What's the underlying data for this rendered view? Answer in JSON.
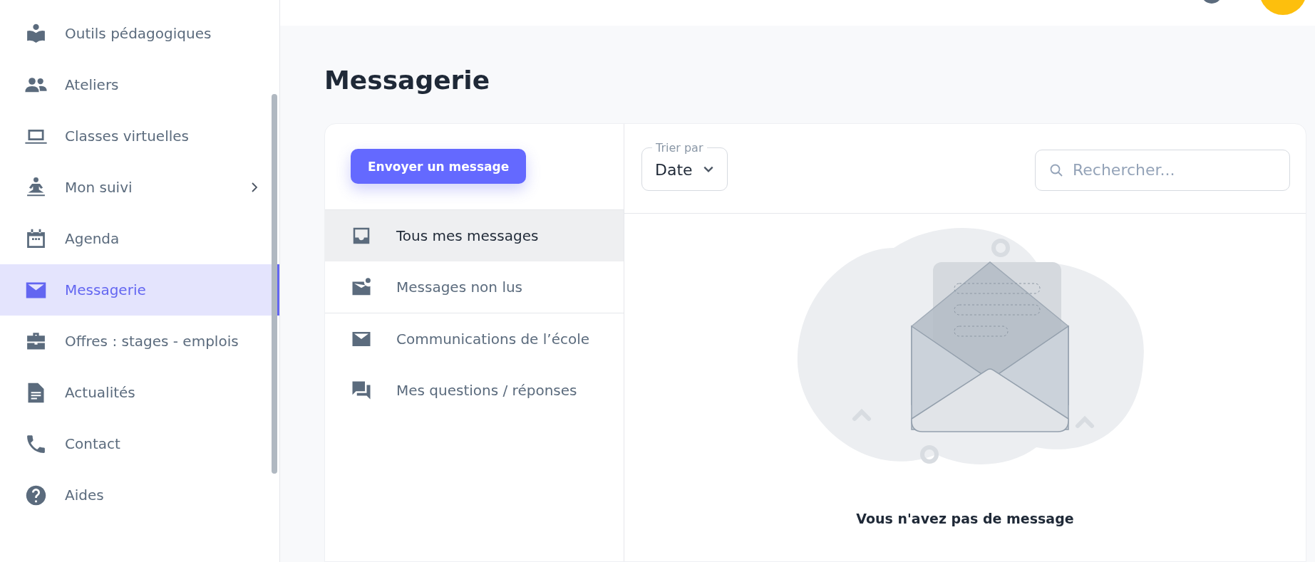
{
  "sidebar": {
    "items": [
      {
        "label": "Outils pédagogiques",
        "selected": false,
        "kind": "link"
      },
      {
        "label": "Ateliers",
        "selected": false,
        "kind": "link"
      },
      {
        "label": "Classes virtuelles",
        "selected": false,
        "kind": "link"
      },
      {
        "label": "Mon suivi",
        "selected": false,
        "kind": "submenu"
      },
      {
        "label": "Agenda",
        "selected": false,
        "kind": "link"
      },
      {
        "label": "Messagerie",
        "selected": true,
        "kind": "link"
      },
      {
        "label": "Offres : stages - emplois",
        "selected": false,
        "kind": "link"
      },
      {
        "label": "Actualités",
        "selected": false,
        "kind": "link"
      },
      {
        "label": "Contact",
        "selected": false,
        "kind": "link"
      },
      {
        "label": "Aides",
        "selected": false,
        "kind": "link"
      }
    ]
  },
  "page": {
    "title": "Messagerie"
  },
  "compose_button": "Envoyer un message",
  "folders": [
    {
      "label": "Tous mes messages",
      "selected": true
    },
    {
      "label": "Messages non lus",
      "selected": false
    },
    {
      "label": "Communications de l’école",
      "selected": false
    },
    {
      "label": "Mes questions / réponses",
      "selected": false
    }
  ],
  "sort": {
    "label": "Trier par",
    "value": "Date"
  },
  "search": {
    "placeholder": "Rechercher..."
  },
  "empty_state": {
    "message": "Vous n'avez pas de message"
  }
}
